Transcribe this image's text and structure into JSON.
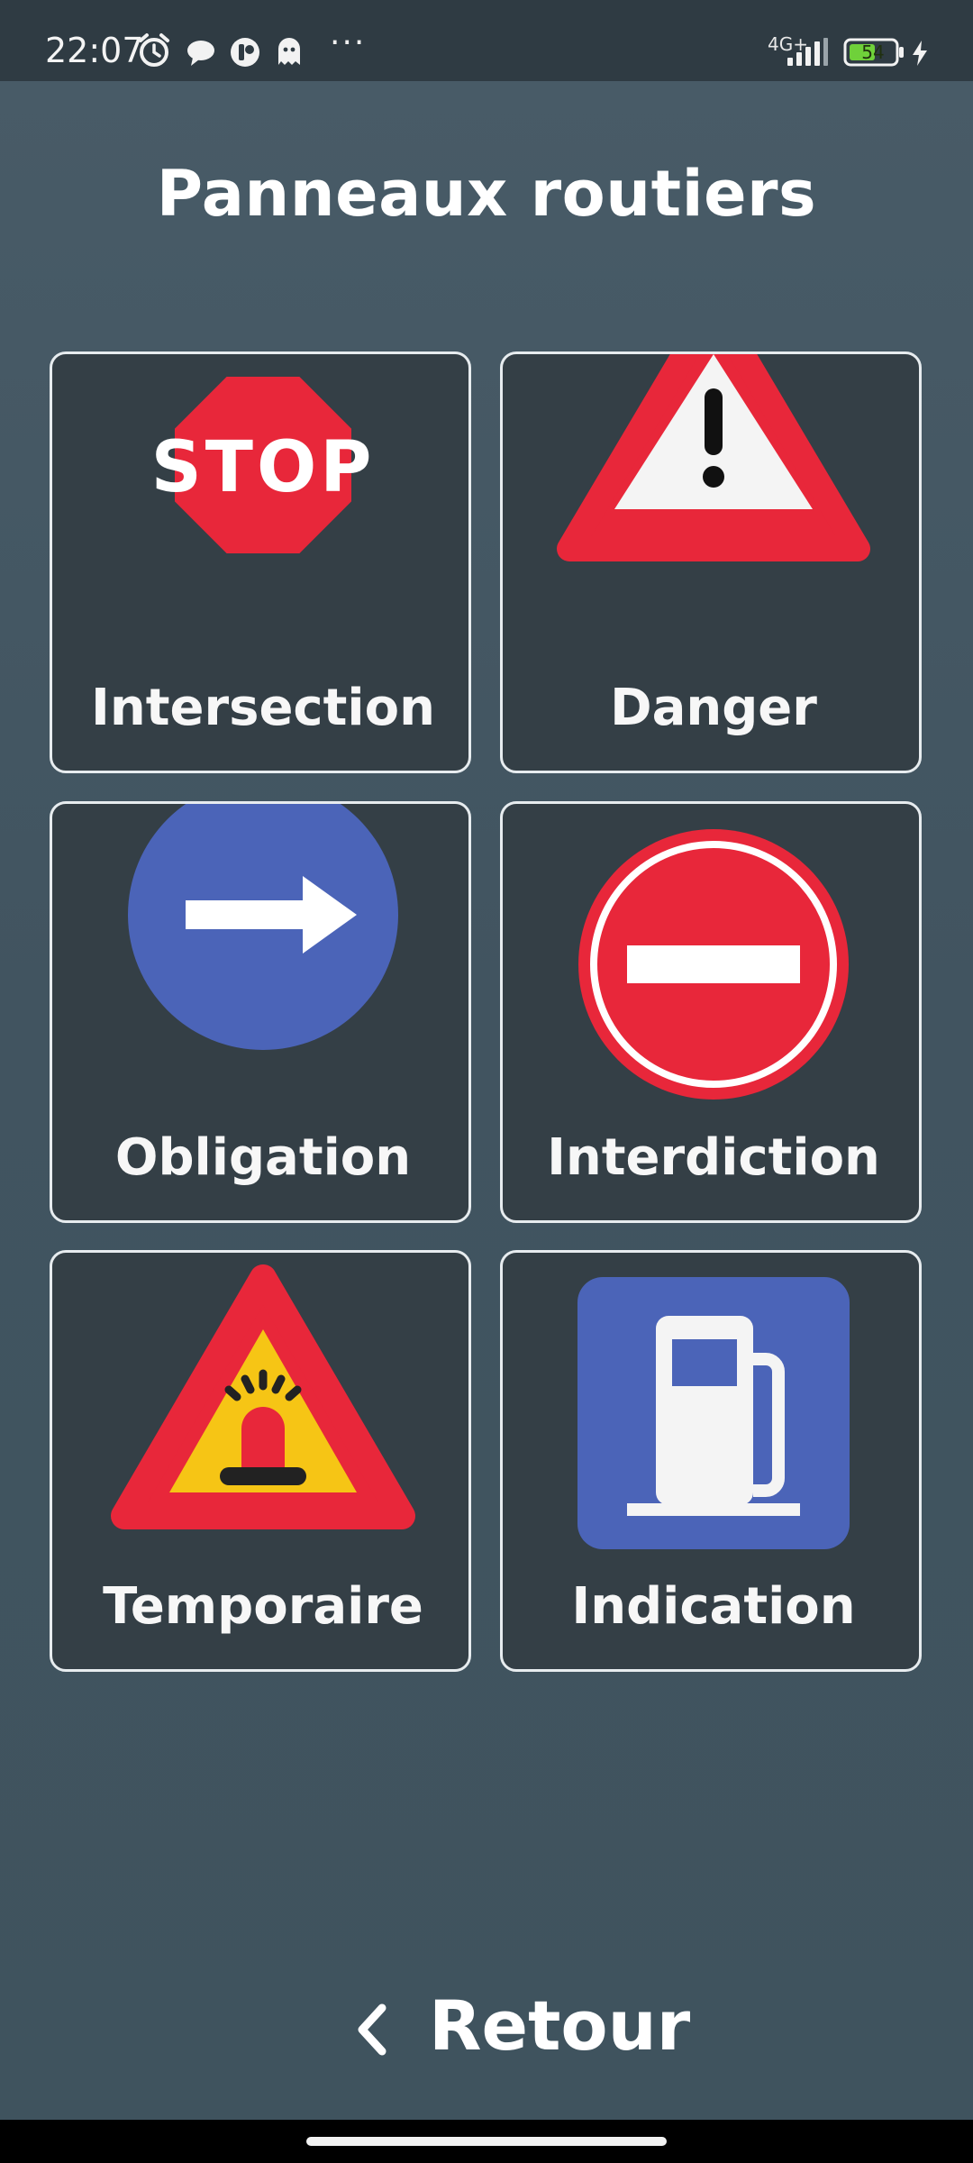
{
  "status_bar": {
    "time": "22:07",
    "more": "···",
    "network": "4G+",
    "battery": "54",
    "icons": [
      "alarm-icon",
      "message-icon",
      "app-notification-icon",
      "ghost-icon",
      "signal-icon",
      "battery-icon",
      "charging-icon"
    ]
  },
  "page": {
    "title": "Panneaux routiers"
  },
  "categories": [
    {
      "label": "Intersection",
      "icon": "stop-sign-icon",
      "sign_text": "STOP"
    },
    {
      "label": "Danger",
      "icon": "danger-warning-sign-icon"
    },
    {
      "label": "Obligation",
      "icon": "mandatory-direction-sign-icon"
    },
    {
      "label": "Interdiction",
      "icon": "no-entry-sign-icon"
    },
    {
      "label": "Temporaire",
      "icon": "temporary-roadwork-sign-icon"
    },
    {
      "label": "Indication",
      "icon": "fuel-station-sign-icon"
    }
  ],
  "footer": {
    "back_label": "Retour"
  },
  "colors": {
    "background": "#415460",
    "card_background": "#343f46",
    "card_border": "#e7ecef",
    "sign_red": "#e8273a",
    "sign_blue": "#4b64b8",
    "sign_yellow": "#f6c515"
  }
}
